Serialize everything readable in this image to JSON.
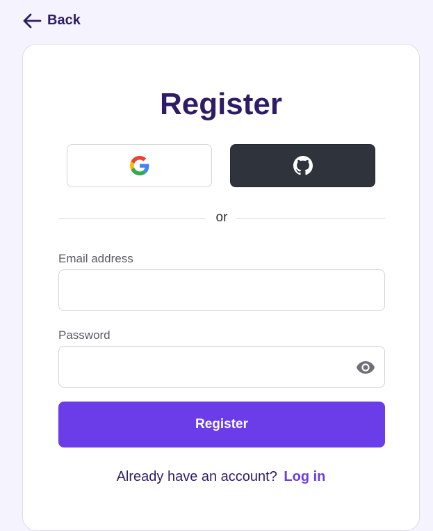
{
  "header": {
    "back_label": "Back"
  },
  "card": {
    "title": "Register",
    "social": {
      "google_icon": "google-icon",
      "github_icon": "github-icon"
    },
    "divider_text": "or",
    "email": {
      "label": "Email address",
      "value": "",
      "placeholder": ""
    },
    "password": {
      "label": "Password",
      "value": "",
      "placeholder": ""
    },
    "register_label": "Register",
    "login_prompt": "Already have an account?",
    "login_link": "Log in"
  },
  "colors": {
    "background": "#f5f4fe",
    "heading": "#2e1d66",
    "accent": "#6a3de8",
    "github_button": "#2f343c"
  }
}
